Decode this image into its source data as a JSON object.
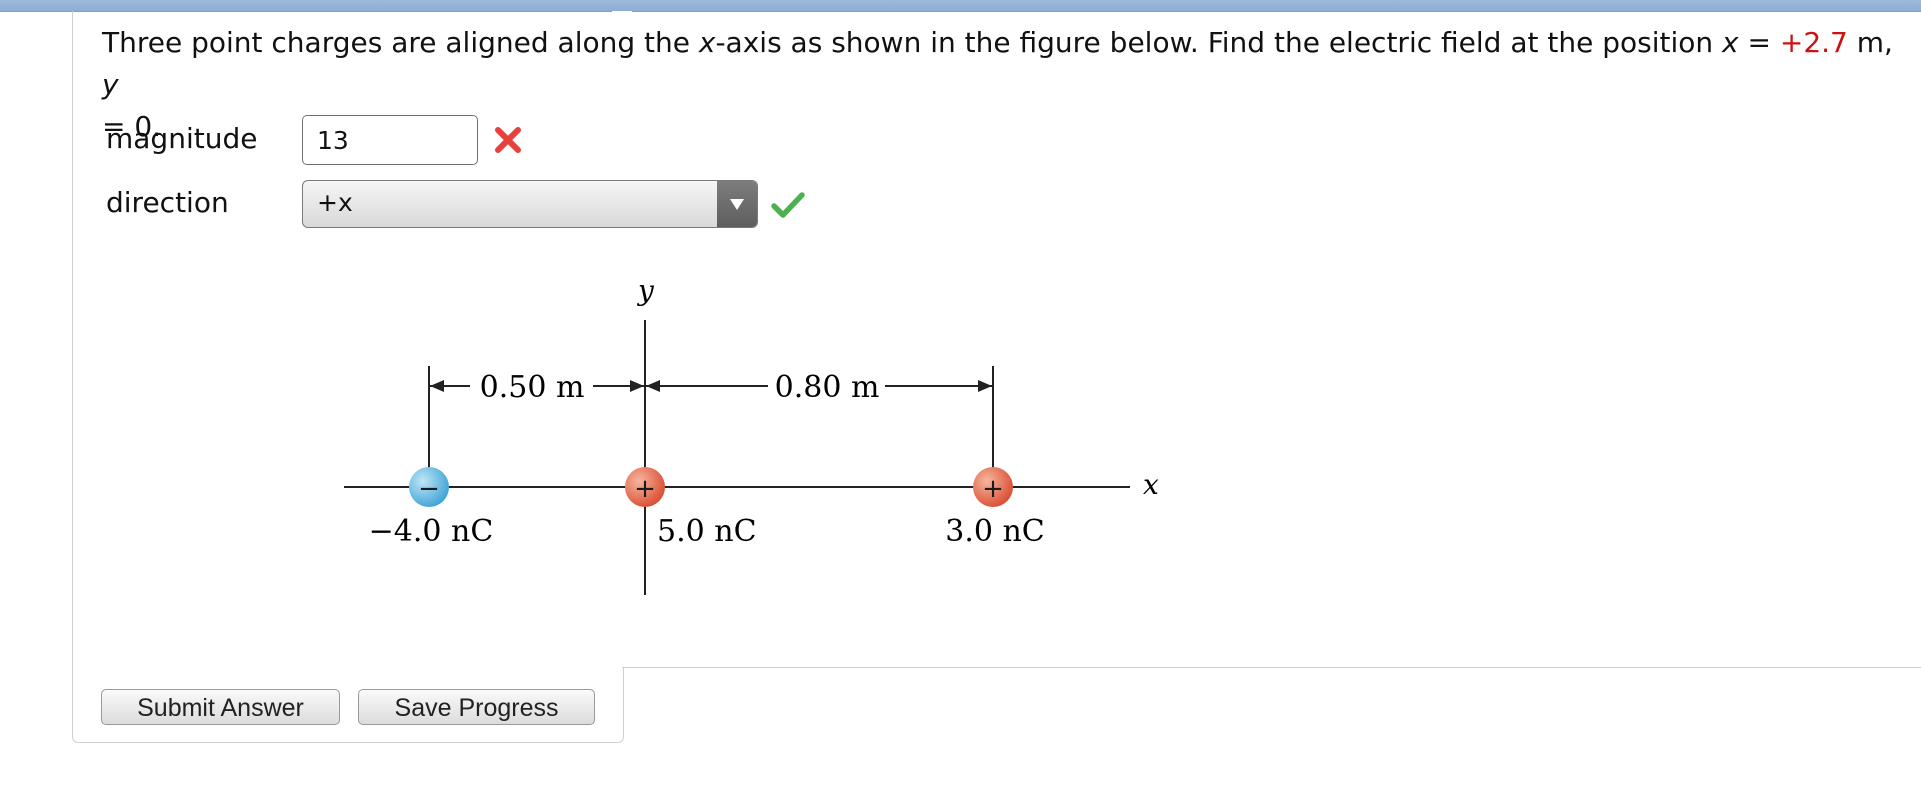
{
  "question": {
    "part1": "Three point charges are aligned along the ",
    "var_x": "x",
    "part2": "-axis as shown in the figure below. Find the electric field at the position ",
    "var_x2": "x",
    "part3": " = ",
    "value": "+2.7",
    "part4": " m, ",
    "var_y": "y",
    "part5": " = 0."
  },
  "magnitude": {
    "label": "magnitude",
    "value": "13",
    "status_icon": "x-icon",
    "status_color": "#e8403a"
  },
  "direction": {
    "label": "direction",
    "selected": "+x",
    "status_icon": "check-icon",
    "status_color": "#4caf50"
  },
  "figure": {
    "y_axis_label": "y",
    "x_axis_label": "x",
    "dim_left": "0.50 m",
    "dim_right": "0.80 m",
    "charges": [
      {
        "sign": "−",
        "label": "−4.0 nC",
        "color": "#5bb7e3"
      },
      {
        "sign": "+",
        "label": "5.0 nC",
        "color": "#e56a4f"
      },
      {
        "sign": "+",
        "label": "3.0 nC",
        "color": "#e56a4f"
      }
    ]
  },
  "buttons": {
    "submit": "Submit Answer",
    "save": "Save Progress"
  }
}
